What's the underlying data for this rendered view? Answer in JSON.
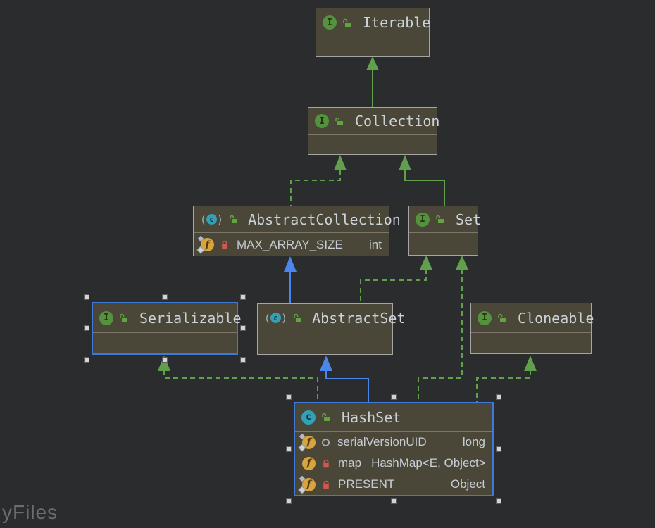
{
  "canvas": {
    "watermark": "yFiles"
  },
  "colors": {
    "background": "#2b2c2d",
    "node_fill": "#4b4738",
    "node_border": "#a5a5a5",
    "node_divider": "#7c776a",
    "selection_blue": "#3e79d9",
    "handle_fill": "#d4d4d4",
    "edge_green": "#60a04c",
    "edge_blue": "#4c86ec",
    "title_text": "#ccd2da",
    "field_text": "#c6cdd5",
    "interface_icon_green": "#55923f",
    "class_icon_teal": "#34a0b5",
    "field_icon_amber": "#d7a43f",
    "lock_green": "#62a442",
    "lock_red": "#cd5a50",
    "package_vis_gray": "#a6abb0",
    "watermark_gray": "#6d6d6d"
  },
  "nodes": [
    {
      "id": "iterable",
      "kind": "interface",
      "visibility": "public",
      "label": "Iterable",
      "selected": false,
      "fields": []
    },
    {
      "id": "collection",
      "kind": "interface",
      "visibility": "public",
      "label": "Collection",
      "selected": false,
      "fields": []
    },
    {
      "id": "abstract-collection",
      "kind": "abstract-class",
      "visibility": "public",
      "label": "AbstractCollection",
      "selected": false,
      "fields": [
        {
          "name": "MAX_ARRAY_SIZE",
          "type": "int",
          "visibility": "private",
          "modifiers": "static final"
        }
      ]
    },
    {
      "id": "set",
      "kind": "interface",
      "visibility": "public",
      "label": "Set",
      "selected": false,
      "fields": []
    },
    {
      "id": "serializable",
      "kind": "interface",
      "visibility": "public",
      "label": "Serializable",
      "selected": true,
      "fields": []
    },
    {
      "id": "abstract-set",
      "kind": "abstract-class",
      "visibility": "public",
      "label": "AbstractSet",
      "selected": false,
      "fields": []
    },
    {
      "id": "cloneable",
      "kind": "interface",
      "visibility": "public",
      "label": "Cloneable",
      "selected": false,
      "fields": []
    },
    {
      "id": "hashset",
      "kind": "class",
      "visibility": "public",
      "label": "HashSet",
      "selected": true,
      "fields": [
        {
          "name": "serialVersionUID",
          "type": "long",
          "visibility": "package-private",
          "modifiers": "static final"
        },
        {
          "name": "map",
          "type": "HashMap<E, Object>",
          "visibility": "private",
          "modifiers": ""
        },
        {
          "name": "PRESENT",
          "type": "Object",
          "visibility": "private",
          "modifiers": "static final"
        }
      ]
    }
  ],
  "edges": [
    {
      "from": "Collection",
      "to": "Iterable",
      "relation": "extends",
      "style": "solid-green"
    },
    {
      "from": "AbstractCollection",
      "to": "Collection",
      "relation": "implements",
      "style": "dashed-green"
    },
    {
      "from": "Set",
      "to": "Collection",
      "relation": "extends",
      "style": "solid-green"
    },
    {
      "from": "AbstractSet",
      "to": "AbstractCollection",
      "relation": "extends",
      "style": "solid-blue"
    },
    {
      "from": "AbstractSet",
      "to": "Set",
      "relation": "implements",
      "style": "dashed-green"
    },
    {
      "from": "HashSet",
      "to": "Set",
      "relation": "implements",
      "style": "dashed-green"
    },
    {
      "from": "HashSet",
      "to": "Serializable",
      "relation": "implements",
      "style": "dashed-green"
    },
    {
      "from": "HashSet",
      "to": "AbstractSet",
      "relation": "extends",
      "style": "solid-blue"
    },
    {
      "from": "HashSet",
      "to": "Cloneable",
      "relation": "implements",
      "style": "dashed-green"
    }
  ]
}
